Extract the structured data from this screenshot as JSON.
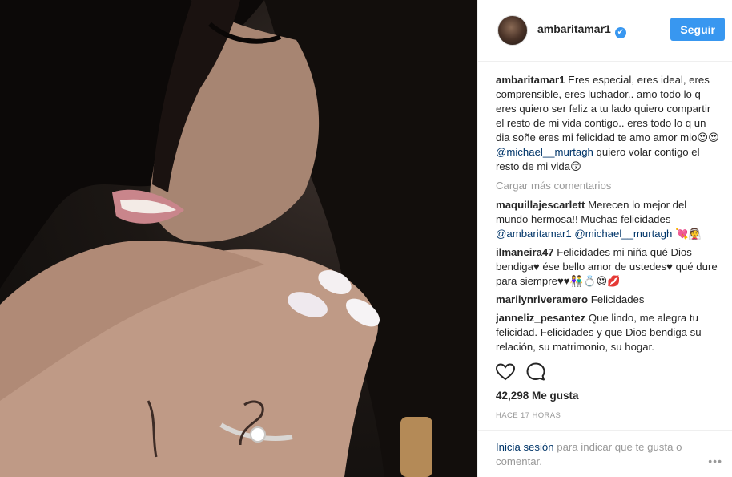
{
  "post": {
    "username": "ambaritamar1",
    "verified_mark": "✔",
    "follow_label": "Seguir",
    "caption_user": "ambaritamar1",
    "caption_text": "Eres especial, eres ideal, eres comprensible, eres luchador.. amo todo lo q eres quiero ser feliz a tu lado quiero compartir el resto de mi vida contigo.. eres todo lo q un dia soñe eres mi felicidad te amo amor mio😍😍 ",
    "caption_mention": "@michael__murtagh",
    "caption_tail": " quiero volar contigo el resto de mi vida😙",
    "load_more": "Cargar más comentarios"
  },
  "comments": [
    {
      "user": "maquillajescarlett",
      "text": "Merecen lo mejor del mundo hermosa!! Muchas felicidades ",
      "mention1": "@ambaritamar1",
      "mention2": "@michael__murtagh",
      "tail": " 💘👰"
    },
    {
      "user": "ilmaneira47",
      "text": "Felicidades mi niña qué Dios bendiga♥ ése bello amor de ustedes♥ qué dure para siempre♥♥👫💍😍💋"
    },
    {
      "user": "marilynriveramero",
      "text": "Felicidades"
    },
    {
      "user": "janneliz_pesantez",
      "text": "Que lindo, me alegra tu felicidad. Felicidades y que Dios bendiga su relación, su matrimonio, su hogar."
    }
  ],
  "stats": {
    "likes": "42,298 Me gusta",
    "time": "HACE 17 HORAS"
  },
  "footer": {
    "login_link": "Inicia sesión",
    "login_text": " para indicar que te gusta o comentar.",
    "more": "•••"
  },
  "icons": {
    "like": "heart-icon",
    "comment": "speech-bubble-icon"
  },
  "colors": {
    "accent": "#3897f0",
    "link": "#003569",
    "muted": "#999999"
  }
}
